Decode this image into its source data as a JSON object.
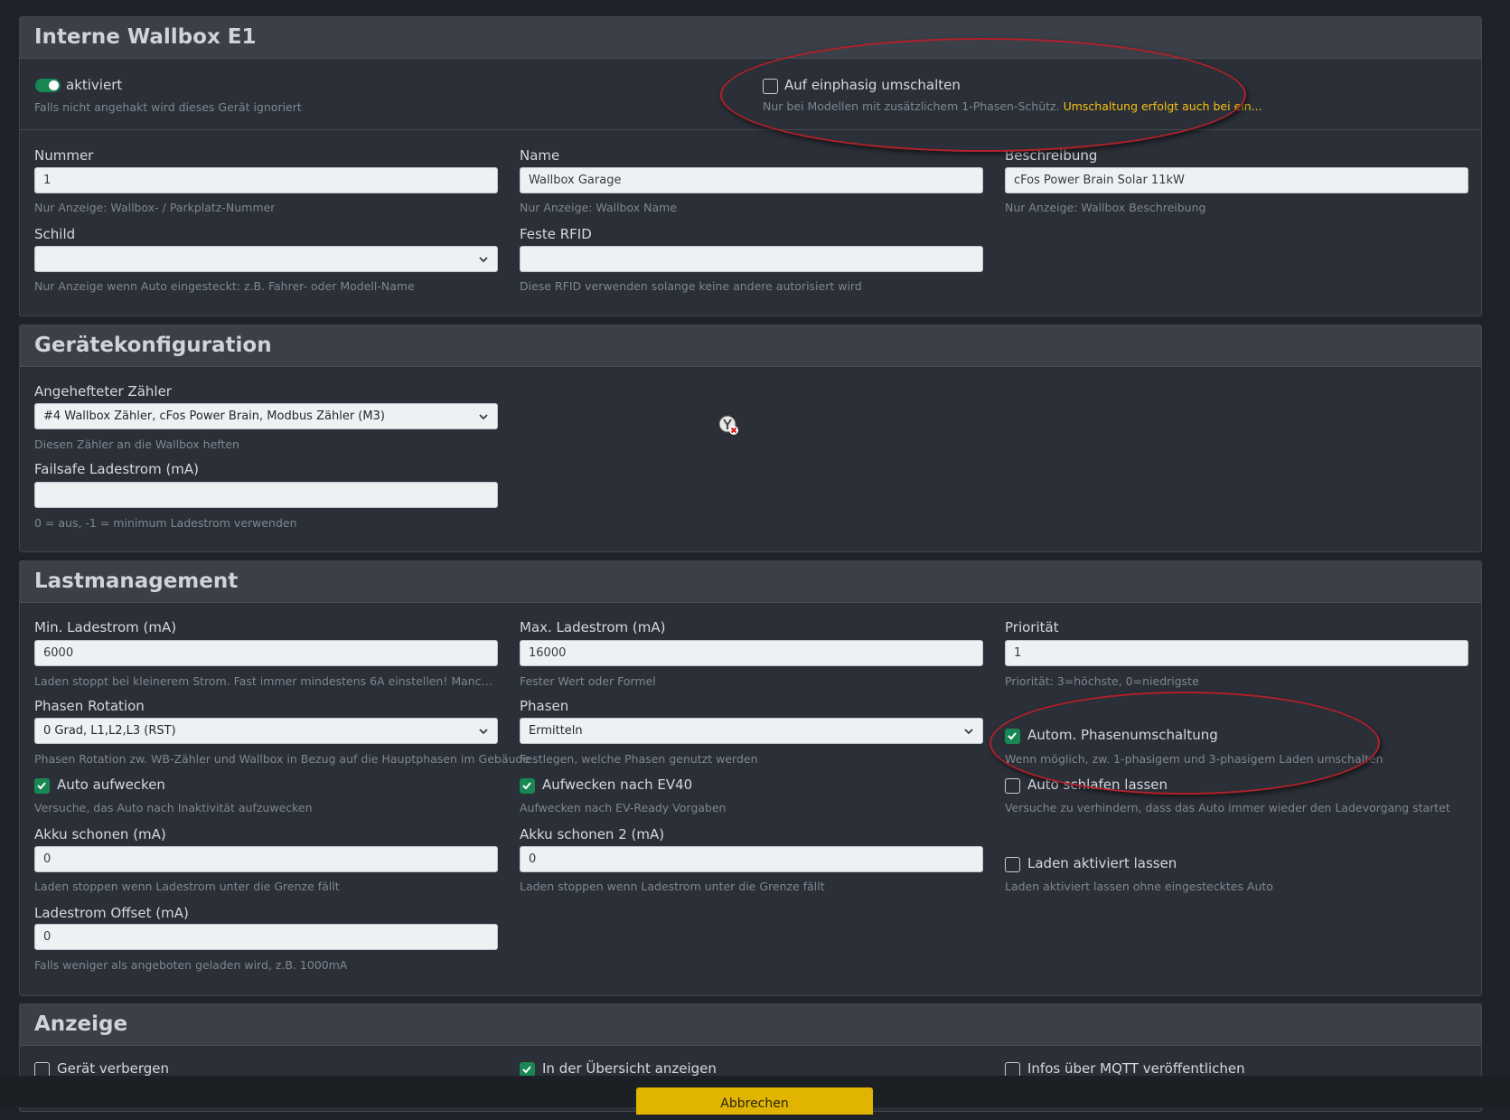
{
  "sections": {
    "wallbox": {
      "title": "Interne Wallbox E1",
      "activated_label": "aktiviert",
      "activated_hint": "Falls nicht angehakt wird dieses Gerät ignoriert",
      "single_phase_label": "Auf einphasig umschalten",
      "single_phase_hint": "Nur bei Modellen mit zusätzlichem 1-Phasen-Schütz.",
      "single_phase_warning": "Umschaltung erfolgt auch bei ein...",
      "number_label": "Nummer",
      "number_value": "1",
      "number_hint": "Nur Anzeige: Wallbox- / Parkplatz-Nummer",
      "name_label": "Name",
      "name_value": "Wallbox Garage",
      "name_hint": "Nur Anzeige: Wallbox Name",
      "desc_label": "Beschreibung",
      "desc_value": "cFos Power Brain Solar 11kW",
      "desc_hint": "Nur Anzeige: Wallbox Beschreibung",
      "sign_label": "Schild",
      "sign_value": "",
      "sign_hint": "Nur Anzeige wenn Auto eingesteckt: z.B. Fahrer- oder Modell-Name",
      "rfid_label": "Feste RFID",
      "rfid_value": "",
      "rfid_hint": "Diese RFID verwenden solange keine andere autorisiert wird"
    },
    "device": {
      "title": "Gerätekonfiguration",
      "meter_label": "Angehefteter Zähler",
      "meter_value": "#4 Wallbox Zähler, cFos Power Brain, Modbus Zähler (M3)",
      "meter_hint": "Diesen Zähler an die Wallbox heften",
      "failsafe_label": "Failsafe Ladestrom (mA)",
      "failsafe_value": "",
      "failsafe_hint": "0 = aus, -1 = minimum Ladestrom verwenden"
    },
    "load": {
      "title": "Lastmanagement",
      "min_label": "Min. Ladestrom (mA)",
      "min_value": "6000",
      "min_hint": "Laden stoppt bei kleinerem Strom. Fast immer mindestens 6A einstellen! Manche Auto...",
      "max_label": "Max. Ladestrom (mA)",
      "max_value": "16000",
      "max_hint": "Fester Wert oder Formel",
      "prio_label": "Priorität",
      "prio_value": "1",
      "prio_hint": "Priorität: 3=höchste, 0=niedrigste",
      "rotation_label": "Phasen Rotation",
      "rotation_value": "0 Grad, L1,L2,L3 (RST)",
      "rotation_hint": "Phasen Rotation zw. WB-Zähler und Wallbox in Bezug auf die Hauptphasen im Gebäude",
      "phases_label": "Phasen",
      "phases_value": "Ermitteln",
      "phases_hint": "Festlegen, welche Phasen genutzt werden",
      "auto_phase_label": "Autom. Phasenumschaltung",
      "auto_phase_hint": "Wenn möglich, zw. 1-phasigem und 3-phasigem Laden umschalten",
      "wake_label": "Auto aufwecken",
      "wake_hint": "Versuche, das Auto nach Inaktivität aufzuwecken",
      "wake_ev40_label": "Aufwecken nach EV40",
      "wake_ev40_hint": "Aufwecken nach EV-Ready Vorgaben",
      "sleep_label": "Auto schlafen lassen",
      "sleep_hint": "Versuche zu verhindern, dass das Auto immer wieder den Ladevorgang startet",
      "battery_label": "Akku schonen (mA)",
      "battery_value": "0",
      "battery_hint": "Laden stoppen wenn Ladestrom unter die Grenze fällt",
      "battery2_label": "Akku schonen 2 (mA)",
      "battery2_value": "0",
      "battery2_hint": "Laden stoppen wenn Ladestrom unter die Grenze fällt",
      "keep_active_label": "Laden aktiviert lassen",
      "keep_active_hint": "Laden aktiviert lassen ohne eingestecktes Auto",
      "offset_label": "Ladestrom Offset (mA)",
      "offset_value": "0",
      "offset_hint": "Falls weniger als angeboten geladen wird, z.B. 1000mA"
    },
    "display": {
      "title": "Anzeige",
      "hide_label": "Gerät verbergen",
      "overview_label": "In der Übersicht anzeigen",
      "mqtt_label": "Infos über MQTT veröffentlichen"
    }
  },
  "footer": {
    "cancel_label": "Abbrechen"
  },
  "colors": {
    "accent_green": "#198754",
    "warning_yellow": "#f5c211",
    "button_yellow": "#e0b400",
    "annotation_red": "#b3202a"
  }
}
